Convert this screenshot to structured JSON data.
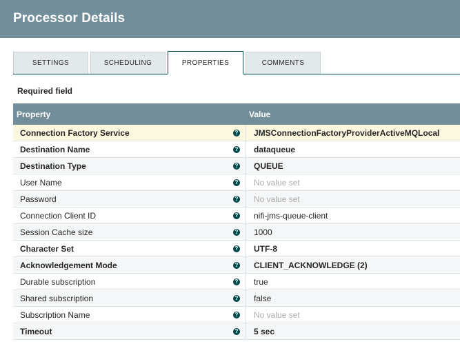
{
  "header": {
    "title": "Processor Details"
  },
  "tabs": [
    {
      "label": "SETTINGS",
      "active": false
    },
    {
      "label": "SCHEDULING",
      "active": false
    },
    {
      "label": "PROPERTIES",
      "active": true
    },
    {
      "label": "COMMENTS",
      "active": false
    }
  ],
  "required_label": "Required field",
  "grid": {
    "columns": {
      "property": "Property",
      "value": "Value"
    },
    "rows": [
      {
        "property": "Connection Factory Service",
        "value": "JMSConnectionFactoryProviderActiveMQLocal",
        "required": true,
        "set": true,
        "selected": true
      },
      {
        "property": "Destination Name",
        "value": "dataqueue",
        "required": true,
        "set": true
      },
      {
        "property": "Destination Type",
        "value": "QUEUE",
        "required": true,
        "set": true
      },
      {
        "property": "User Name",
        "value": "No value set",
        "required": false,
        "set": false
      },
      {
        "property": "Password",
        "value": "No value set",
        "required": false,
        "set": false
      },
      {
        "property": "Connection Client ID",
        "value": "nifi-jms-queue-client",
        "required": false,
        "set": true
      },
      {
        "property": "Session Cache size",
        "value": "1000",
        "required": false,
        "set": true
      },
      {
        "property": "Character Set",
        "value": "UTF-8",
        "required": true,
        "set": true
      },
      {
        "property": "Acknowledgement Mode",
        "value": "CLIENT_ACKNOWLEDGE (2)",
        "required": true,
        "set": true
      },
      {
        "property": "Durable subscription",
        "value": "true",
        "required": false,
        "set": true
      },
      {
        "property": "Shared subscription",
        "value": "false",
        "required": false,
        "set": true
      },
      {
        "property": "Subscription Name",
        "value": "No value set",
        "required": false,
        "set": false
      },
      {
        "property": "Timeout",
        "value": "5 sec",
        "required": true,
        "set": true
      }
    ]
  },
  "help_icon_glyph": "?",
  "colors": {
    "header_bg": "#728e9b",
    "accent": "#004849",
    "selected_row": "#fcf7df"
  }
}
